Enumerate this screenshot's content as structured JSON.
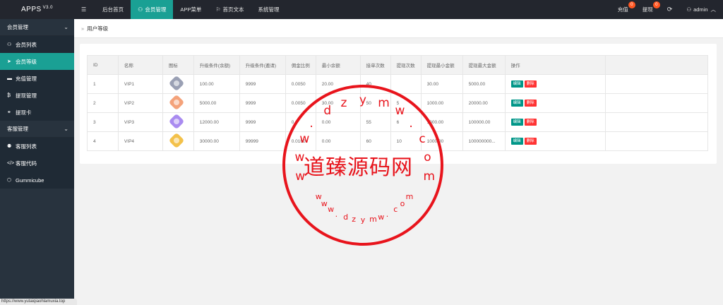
{
  "app": {
    "name": "APPS",
    "version": "V3.0"
  },
  "topnav": {
    "menu_icon": "menu-icon",
    "items": [
      {
        "label": "后台首页",
        "icon": ""
      },
      {
        "label": "会员管理",
        "icon": "user-icon",
        "active": true
      },
      {
        "label": "APP菜单",
        "icon": ""
      },
      {
        "label": "首页文本",
        "icon": "flag-icon"
      },
      {
        "label": "系统管理",
        "icon": ""
      }
    ],
    "right": {
      "recharge_label": "充值",
      "recharge_badge": "0",
      "withdraw_label": "提现",
      "withdraw_badge": "0",
      "refresh_icon": "refresh-icon",
      "user_label": "admin"
    }
  },
  "sidebar": {
    "group1": "会员管理",
    "items1": [
      {
        "label": "会员列表",
        "icon": "user-icon"
      },
      {
        "label": "会员等级",
        "icon": "send-icon",
        "active": true
      },
      {
        "label": "充值管理",
        "icon": "card-icon"
      },
      {
        "label": "提现管理",
        "icon": "bitcoin-icon"
      },
      {
        "label": "提现卡",
        "icon": "link-icon"
      }
    ],
    "group2": "客服管理",
    "items2": [
      {
        "label": "客服列表",
        "icon": "users-icon"
      },
      {
        "label": "客服代码",
        "icon": "code-icon"
      },
      {
        "label": "Gummicube",
        "icon": "cube-icon"
      }
    ]
  },
  "breadcrumb": {
    "current": "用户等级"
  },
  "table": {
    "headers": [
      "ID",
      "名称",
      "图标",
      "升级条件(余额)",
      "升级条件(邀请)",
      "佣金比例",
      "最小余额",
      "接单次数",
      "提现次数",
      "提现最小金额",
      "提现最大金额",
      "操作"
    ],
    "rows": [
      {
        "id": "1",
        "name": "VIP1",
        "color": "#9aa0b4",
        "balance": "100.00",
        "invite": "9999",
        "rate": "0.0050",
        "min": "20.00",
        "orders": "40",
        "withdraws": "",
        "wmin": "30.00",
        "wmax": "5000.00"
      },
      {
        "id": "2",
        "name": "VIP2",
        "color": "#f4a27a",
        "balance": "5000.00",
        "invite": "9999",
        "rate": "0.0050",
        "min": "30.00",
        "orders": "50",
        "withdraws": "5",
        "wmin": "1000.00",
        "wmax": "20000.00"
      },
      {
        "id": "3",
        "name": "VIP3",
        "color": "#a98bf0",
        "balance": "12000.00",
        "invite": "9999",
        "rate": "0.0",
        "min": "0.00",
        "orders": "55",
        "withdraws": "6",
        "wmin": "1000.00",
        "wmax": "100000.00"
      },
      {
        "id": "4",
        "name": "VIP4",
        "color": "#f3c14a",
        "balance": "30000.00",
        "invite": "99999",
        "rate": "0.0100",
        "min": "0.00",
        "orders": "60",
        "withdraws": "10",
        "wmin": "1000.00",
        "wmax": "100000000..."
      }
    ],
    "edit_label": "编辑",
    "delete_label": "删除"
  },
  "watermark": {
    "center": "道臻源码网",
    "url_chars": [
      "w",
      "w",
      "w",
      ".",
      "d",
      "z",
      "y",
      "m",
      "w",
      ".",
      "c",
      "o",
      "m"
    ]
  },
  "statusbar": {
    "url": "https://www.yutaiqiaohlamuxia.top"
  }
}
